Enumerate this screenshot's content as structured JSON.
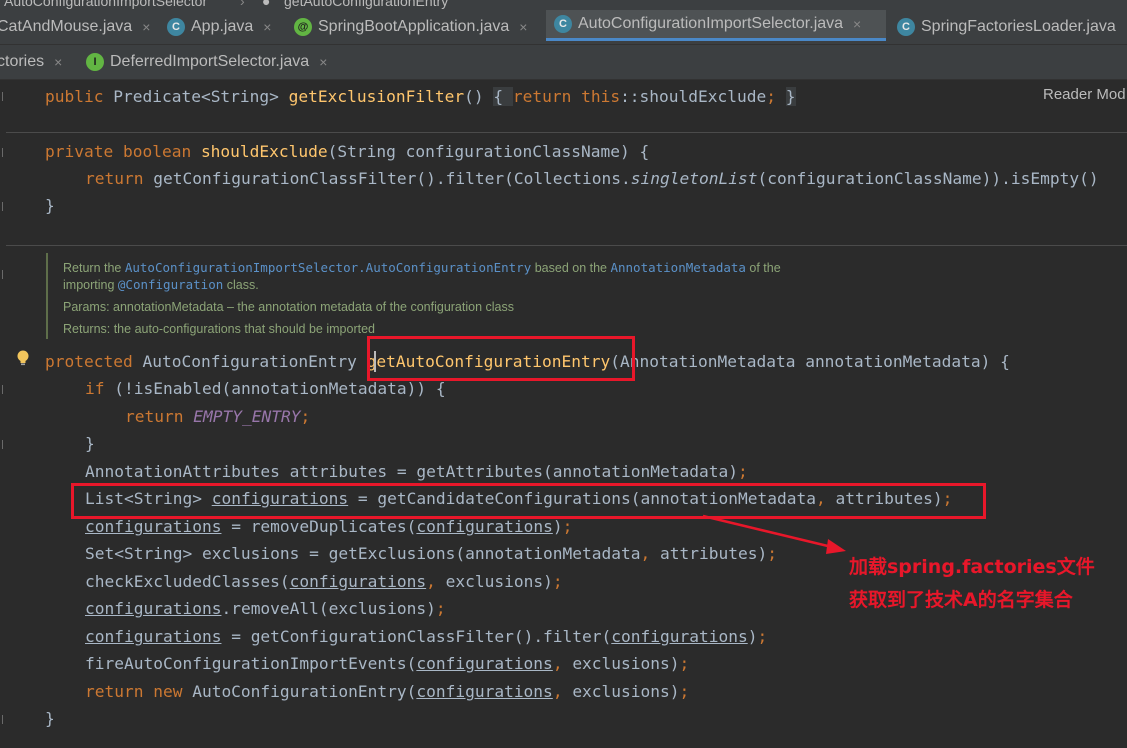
{
  "breadcrumb": {
    "class_crumb": "AutoConfigurationImportSelector",
    "method_crumb": "getAutoConfigurationEntry"
  },
  "tabs_row1": [
    {
      "label": "CatAndMouse.java",
      "icon": "class-icon",
      "active": false
    },
    {
      "label": "App.java",
      "icon": "class-icon",
      "active": false
    },
    {
      "label": "SpringBootApplication.java",
      "icon": "annotation-icon",
      "active": false
    },
    {
      "label": "AutoConfigurationImportSelector.java",
      "icon": "class-icon",
      "active": true
    },
    {
      "label": "SpringFactoriesLoader.java",
      "icon": "class-icon",
      "active": false
    }
  ],
  "tabs_row2": [
    {
      "label": "ctories",
      "icon": "",
      "active": false
    },
    {
      "label": "DeferredImportSelector.java",
      "icon": "interface-icon",
      "active": false
    }
  ],
  "tab_close_glyph": "×",
  "icon_letters": {
    "class": "C",
    "annotation": "@",
    "interface": "I"
  },
  "reader_mode": "Reader Mod",
  "code": {
    "l1": {
      "a": "public ",
      "b": "Predicate<String> ",
      "c": "getExclusionFilter",
      "d": "() ",
      "e": "{ ",
      "f": "return this",
      "g": "::shouldExclude",
      "h": "; ",
      "i": "}"
    },
    "l2": {
      "a": "private boolean ",
      "b": "shouldExclude",
      "c": "(String configurationClassName) {"
    },
    "l3": {
      "a": "return ",
      "b": "getConfigurationClassFilter().filter(Collections.",
      "c": "singletonList",
      "d": "(configurationClassName)).isEmpty()"
    },
    "l4": "}",
    "l5": {
      "a": "protected ",
      "b": "AutoConfigurationEntry ",
      "c": "getAutoConfigurationEntry",
      "d": "(AnnotationMetadata annotationMetadata) {"
    },
    "l6": {
      "a": "if ",
      "b": "(!isEnabled(annotationMetadata)) {"
    },
    "l7": {
      "a": "return ",
      "b": "EMPTY_ENTRY",
      "c": ";"
    },
    "l8": "}",
    "l9": {
      "a": "AnnotationAttributes attributes = getAttributes(annotationMetadata)",
      "b": ";"
    },
    "l10": {
      "a": "List<String> ",
      "b": "configurations",
      "c": " = getCandidateConfigurations(annotationMetadata",
      "d": ", ",
      "e": "attributes)",
      "f": ";"
    },
    "l11": {
      "a": "configurations",
      "b": " = removeDuplicates(",
      "c": "configurations",
      "d": ")",
      "e": ";"
    },
    "l12": {
      "a": "Set<String> exclusions = getExclusions(annotationMetadata",
      "b": ", ",
      "c": "attributes)",
      "d": ";"
    },
    "l13": {
      "a": "checkExcludedClasses(",
      "b": "configurations",
      "c": ", ",
      "d": "exclusions)",
      "e": ";"
    },
    "l14": {
      "a": "configurations",
      "b": ".removeAll(exclusions)",
      "c": ";"
    },
    "l15": {
      "a": "configurations",
      "b": " = getConfigurationClassFilter().filter(",
      "c": "configurations",
      "d": ")",
      "e": ";"
    },
    "l16": {
      "a": "fireAutoConfigurationImportEvents(",
      "b": "configurations",
      "c": ", ",
      "d": "exclusions)",
      "e": ";"
    },
    "l17": {
      "a": "return new ",
      "b": "AutoConfigurationEntry(",
      "c": "configurations",
      "d": ", ",
      "e": "exclusions)",
      "f": ";"
    },
    "l18": "}"
  },
  "javadoc": {
    "line1_a": "Return the ",
    "line1_ref1": "AutoConfigurationImportSelector.AutoConfigurationEntry",
    "line1_b": " based on the ",
    "line1_ref2": "AnnotationMetadata",
    "line1_c": " of the",
    "line2_a": "importing ",
    "line2_ref": "@Configuration",
    "line2_b": " class.",
    "params": "Params:  annotationMetadata – the annotation metadata of the configuration class",
    "returns": "Returns:  the auto-configurations that should be imported"
  },
  "annotation": {
    "line1": "加载spring.factories文件",
    "line2": "获取到了技术A的名字集合"
  },
  "colors": {
    "keyword": "#cc7832",
    "method": "#ffc66d",
    "constant": "#9876aa",
    "highlight": "#e8172a",
    "doc_text": "#8ca477",
    "doc_ref": "#5b91c8"
  }
}
